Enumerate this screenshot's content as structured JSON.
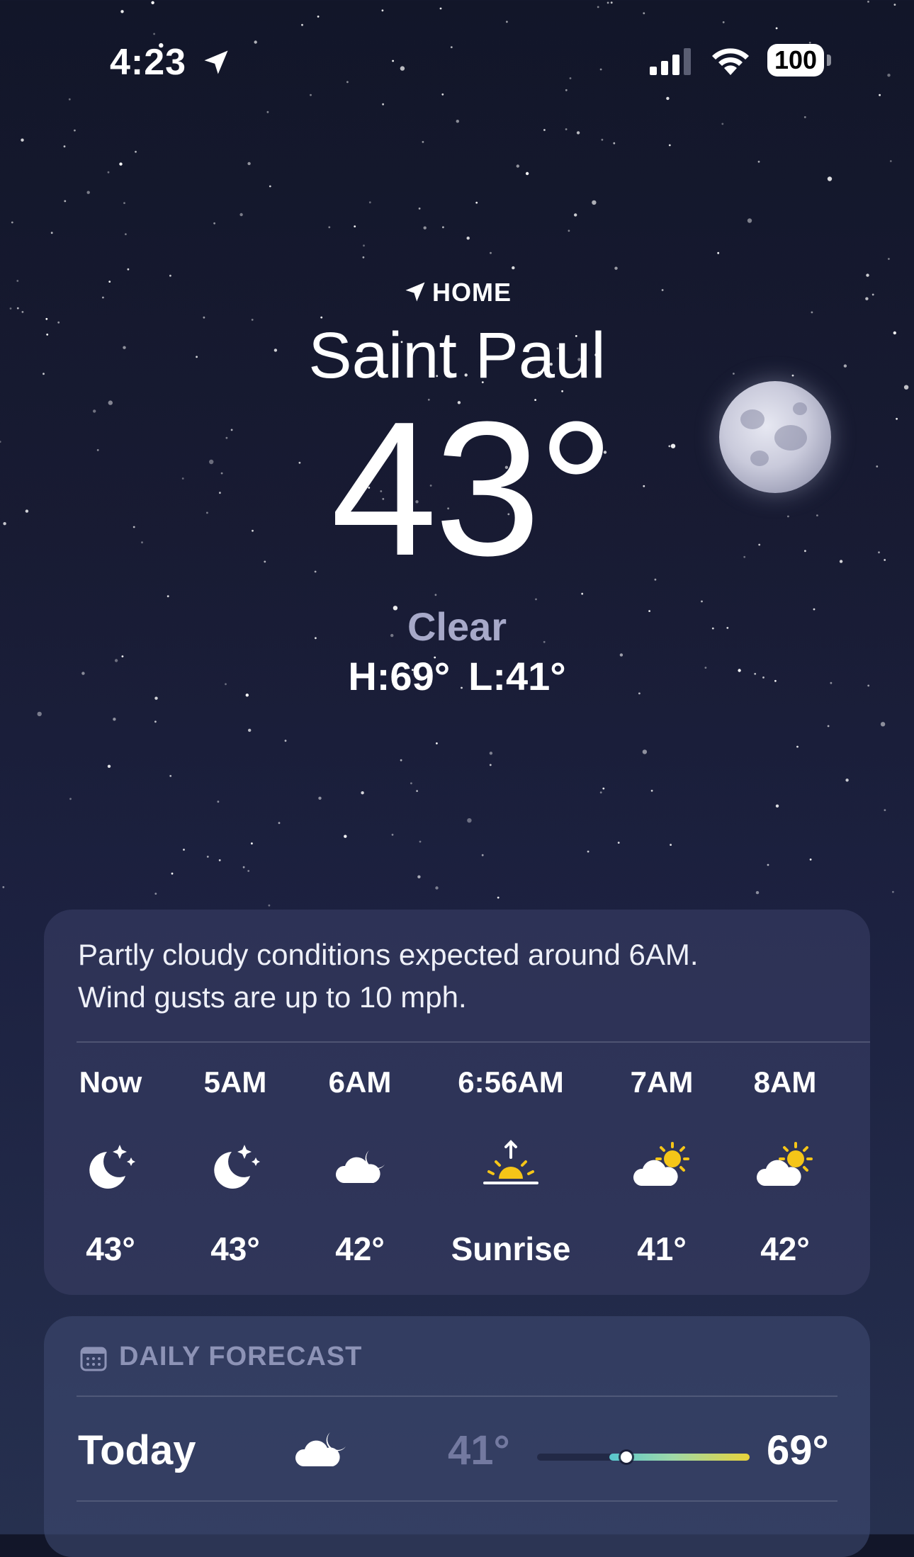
{
  "status_bar": {
    "time": "4:23",
    "battery": "100",
    "icons": [
      "location-arrow-icon",
      "cellular-signal-icon",
      "wifi-icon",
      "battery-icon"
    ]
  },
  "location": {
    "tag": "HOME",
    "city": "Saint Paul",
    "temperature": "43°",
    "condition": "Clear",
    "high": "H:69°",
    "low": "L:41°"
  },
  "hourly": {
    "summary_line1": "Partly cloudy conditions expected around 6AM.",
    "summary_line2": "Wind gusts are up to 10 mph.",
    "hours": [
      {
        "label": "Now",
        "icon": "moon-stars-icon",
        "temp": "43°"
      },
      {
        "label": "5AM",
        "icon": "moon-stars-icon",
        "temp": "43°"
      },
      {
        "label": "6AM",
        "icon": "cloud-moon-icon",
        "temp": "42°"
      },
      {
        "label": "6:56AM",
        "icon": "sunrise-icon",
        "temp": "Sunrise"
      },
      {
        "label": "7AM",
        "icon": "cloud-sun-icon",
        "temp": "41°"
      },
      {
        "label": "8AM",
        "icon": "cloud-sun-icon",
        "temp": "42°"
      }
    ]
  },
  "daily": {
    "header": "DAILY FORECAST",
    "header_icon": "calendar-icon",
    "days": [
      {
        "name": "Today",
        "icon": "cloud-moon-icon",
        "low": "41°",
        "high": "69°",
        "range_start": 0.34,
        "range_end": 1.0,
        "current_position": 0.42
      }
    ]
  },
  "colors": {
    "background_top": "#121629",
    "background_bottom": "#26304f",
    "condition_text": "#a7a9c9",
    "sun_yellow": "#f5c518",
    "range_start": "#58c7cf",
    "range_end": "#e9d43a"
  }
}
